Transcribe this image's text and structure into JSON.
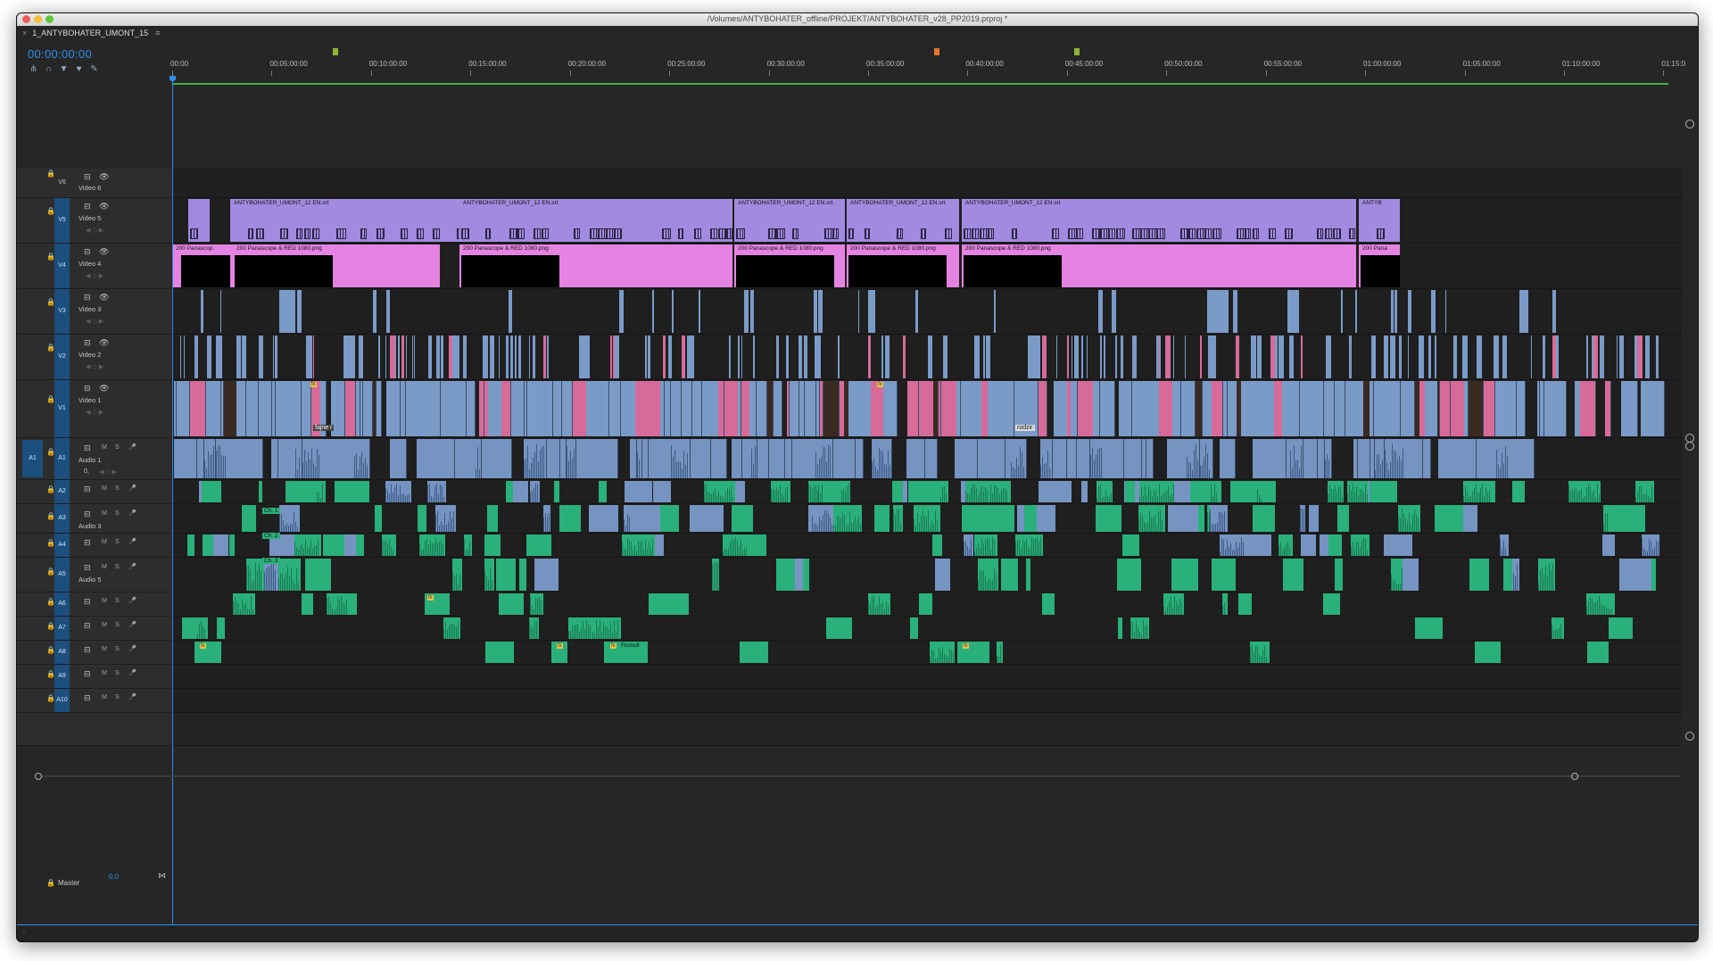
{
  "window": {
    "title": "/Volumes/ANTYBOHATER_offline/PROJEKT/ANTYBOHATER_v28_PP2019.prproj *"
  },
  "sequence": {
    "tab_label": "1_ANTYBOHATER_UMONT_15",
    "close_glyph": "×",
    "menu_glyph": "≡",
    "timecode": "00:00:00:00"
  },
  "tools": [
    {
      "name": "snap-icon",
      "glyph": "⋔"
    },
    {
      "name": "linked-selection-icon",
      "glyph": "∩"
    },
    {
      "name": "add-marker-icon",
      "glyph": "▼"
    },
    {
      "name": "marker-icon",
      "glyph": "♥"
    },
    {
      "name": "wrench-icon",
      "glyph": "✎"
    }
  ],
  "ruler": {
    "ticks": [
      "00:00",
      "00:05:00:00",
      "00:10:00:00",
      "00:15:00:00",
      "00:20:00:00",
      "00:25:00:00",
      "00:30:00:00",
      "00:35:00:00",
      "00:40:00:00",
      "00:45:00:00",
      "00:50:00:00",
      "00:55:00:00",
      "01:00:00:00",
      "01:05:00:00",
      "01:10:00:00",
      "01:15:0"
    ]
  },
  "markers": [
    {
      "color": "#8db334"
    },
    {
      "color": "#e3772a"
    },
    {
      "color": "#8db334"
    }
  ],
  "video_tracks": [
    {
      "id": "V6",
      "name": "Video 6"
    },
    {
      "id": "V5",
      "name": "Video 5"
    },
    {
      "id": "V4",
      "name": "Video 4"
    },
    {
      "id": "V3",
      "name": "Video 3"
    },
    {
      "id": "V2",
      "name": "Video 2"
    },
    {
      "id": "V1",
      "name": "Video 1"
    }
  ],
  "audio_tracks": [
    {
      "id": "A1",
      "name": "Audio 1",
      "source": "A1"
    },
    {
      "id": "A2",
      "name": ""
    },
    {
      "id": "A3",
      "name": "Audio 3"
    },
    {
      "id": "A4",
      "name": ""
    },
    {
      "id": "A5",
      "name": "Audio 5"
    },
    {
      "id": "A6",
      "name": ""
    },
    {
      "id": "A7",
      "name": ""
    },
    {
      "id": "A8",
      "name": ""
    },
    {
      "id": "A9",
      "name": ""
    },
    {
      "id": "A10",
      "name": ""
    }
  ],
  "track_buttons": {
    "mute": "M",
    "solo": "S",
    "mic": "🎤",
    "eye": "👁",
    "toggle": "⊟",
    "lock": "🔒"
  },
  "a1_volume": "0,",
  "master": {
    "label": "Master",
    "volume": "0,0",
    "end_glyph": "⋈"
  },
  "clip_labels": {
    "subtitles": "ANTYBOHATER_UMONT_12 EN.srt",
    "panascope": "200 Panascope & RED 1080.png",
    "panascope_short": "200 Panascop",
    "panascope_tail": "200 Pana",
    "subs_tail": "ANTYB",
    "fx": "fx",
    "fx_clip": "Fismoll",
    "v1_label1": "fajne r",
    "v1_label2": "rodzir",
    "ch1": "Ch. 1",
    "ch2": "Ch. 2",
    "ch3": "Ch. 3"
  },
  "colors": {
    "accent": "#2f8fe8",
    "subtitle_clip": "#a18ae0",
    "graphic_clip": "#e583e2",
    "video_clip": "#7a9bc8",
    "video_clip_pink": "#d66b9a",
    "audio_clip": "#2ab07a",
    "audio_clip_blue": "#7594c2",
    "work_area": "#3fb33f"
  }
}
